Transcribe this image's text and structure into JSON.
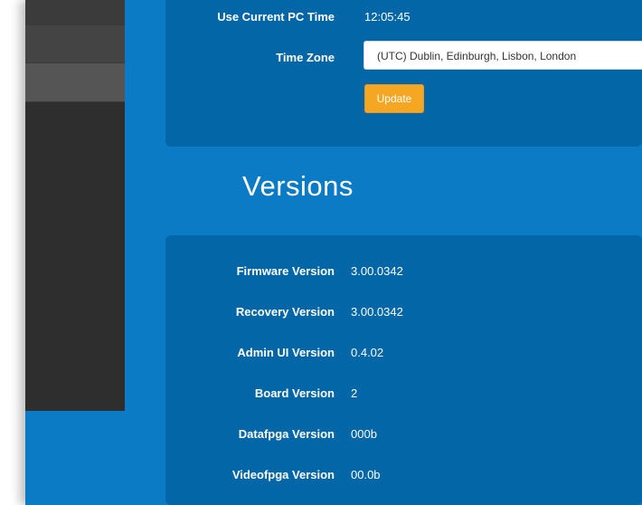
{
  "time_settings": {
    "current_time_label": "Use Current PC Time",
    "current_time_value": "12:05:45",
    "timezone_label": "Time Zone",
    "timezone_value": "(UTC) Dublin, Edinburgh, Lisbon, London",
    "update_label": "Update",
    "update_color": "#f5a623"
  },
  "versions": {
    "title": "Versions",
    "rows": [
      {
        "label": "Firmware Version",
        "value": "3.00.0342"
      },
      {
        "label": "Recovery Version",
        "value": "3.00.0342"
      },
      {
        "label": "Admin UI Version",
        "value": "0.4.02"
      },
      {
        "label": "Board Version",
        "value": "2"
      },
      {
        "label": "Datafpga Version",
        "value": "000b"
      },
      {
        "label": "Videofpga Version",
        "value": "00.0b"
      }
    ]
  },
  "colors": {
    "background": "#0a7bc4",
    "card": "#0366a7",
    "sidebar": "#2e2e2e"
  },
  "icons": {
    "select_arrow": "dropdown-arrow-icon"
  }
}
